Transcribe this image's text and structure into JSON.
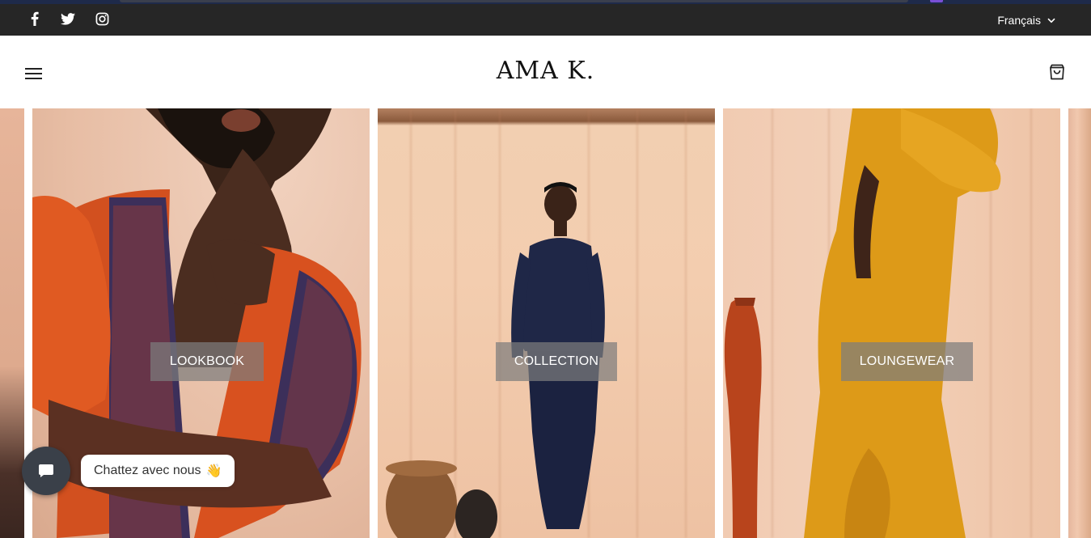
{
  "topbar": {
    "social": [
      "facebook-icon",
      "twitter-icon",
      "instagram-icon"
    ],
    "language": "Français"
  },
  "header": {
    "logo": "AMA K.",
    "menu_icon": "hamburger-icon",
    "cart_icon": "shopping-bag-icon"
  },
  "gallery": {
    "slides": [
      {
        "label": "LOOKBOOK"
      },
      {
        "label": "COLLECTION"
      },
      {
        "label": "LOUNGEWEAR"
      }
    ]
  },
  "chat": {
    "label": "Chattez avec nous",
    "emoji": "👋",
    "icon": "chat-icon"
  },
  "colors": {
    "topbar_bg": "#262626",
    "overlay_button_bg": "#7d7d7d",
    "chat_bubble_bg": "#3a4049"
  }
}
